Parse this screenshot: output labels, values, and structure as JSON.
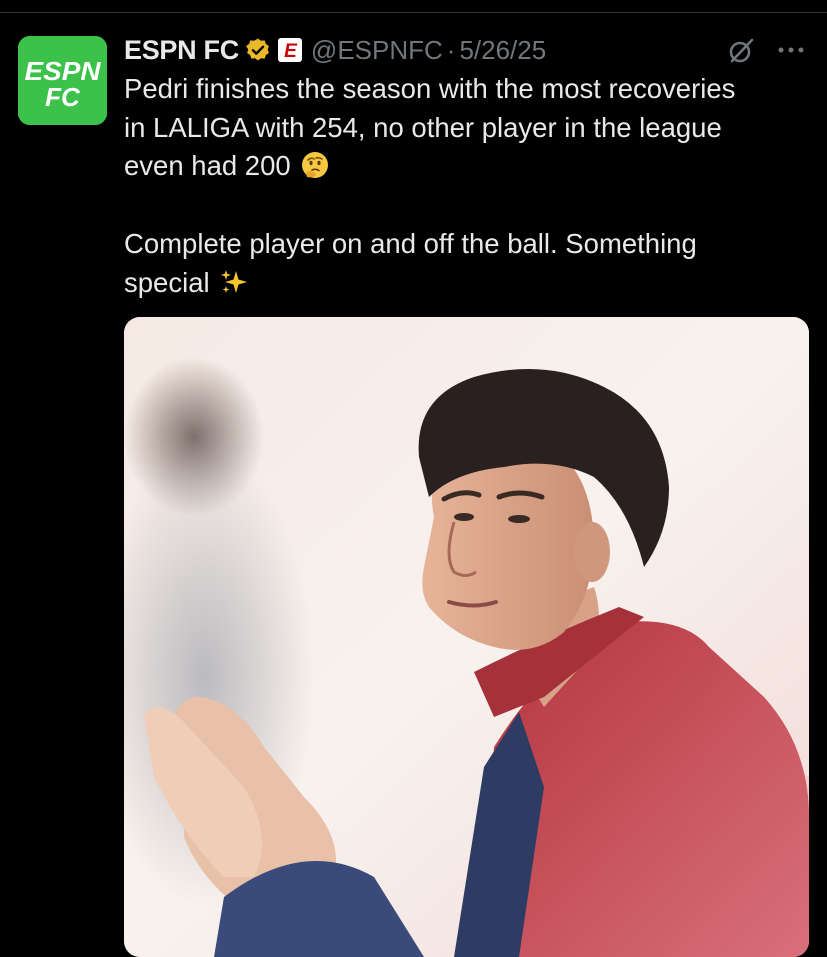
{
  "tweet": {
    "author": {
      "display_name": "ESPN FC",
      "handle": "@ESPNFC",
      "avatar_text_top": "ESPN",
      "avatar_text_bottom": "FC",
      "avatar_color": "#3cc24a",
      "verified_badge_color": "#e8b829",
      "affiliate_badge_letter": "E",
      "affiliate_badge_color": "#cc0000"
    },
    "separator": "·",
    "date": "5/26/25",
    "text_lines": [
      "Pedri finishes the season with the most recoveries",
      "in LALIGA with 254, no other player in the league",
      "even had 200"
    ],
    "text_lines_2": [
      "Complete player on and off the ball. Something",
      "special"
    ],
    "emoji_1": "thinking-face-emoji",
    "emoji_2": "sparkles-emoji",
    "media": {
      "subject": "player-photo"
    },
    "icons": {
      "grok": "grok-icon",
      "more": "more-options-icon"
    }
  },
  "colors": {
    "background": "#000000",
    "text_primary": "#e7e9ea",
    "text_secondary": "#71767b",
    "divider": "#2f3336"
  }
}
